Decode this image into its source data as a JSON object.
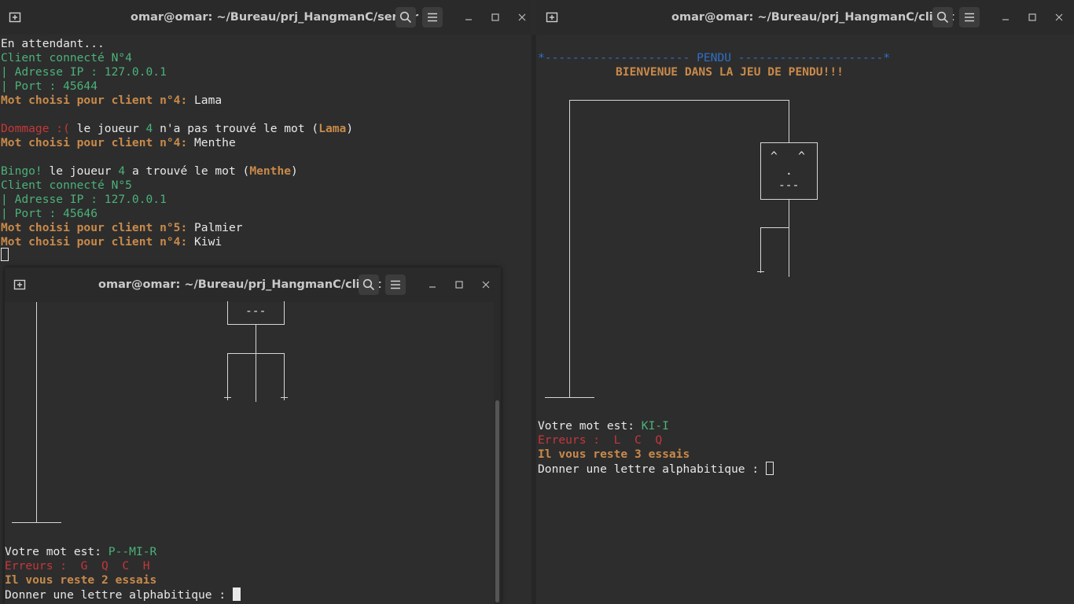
{
  "server": {
    "title": "omar@omar: ~/Bureau/prj_HangmanC/server",
    "lines": {
      "l1": "En attendant...",
      "l2": "Client connecté N°4",
      "l3": "| Adresse IP : 127.0.0.1",
      "l4": "| Port : 45644",
      "l5a": "Mot choisi pour client n°4:",
      "l5b": " Lama",
      "l6a": "Dommage :(",
      "l6b": " le joueur ",
      "l6c": "4",
      "l6d": " n'a pas trouvé le mot (",
      "l6e": "Lama",
      "l6f": ")",
      "l7a": "Mot choisi pour client n°4:",
      "l7b": " Menthe",
      "l8a": "Bingo!",
      "l8b": " le joueur ",
      "l8c": "4",
      "l8d": " a trouvé le mot (",
      "l8e": "Menthe",
      "l8f": ")",
      "l9": "Client connecté N°5",
      "l10": "| Adresse IP : 127.0.0.1",
      "l11": "| Port : 45646",
      "l12a": "Mot choisi pour client n°5:",
      "l12b": " Palmier",
      "l13a": "Mot choisi pour client n°4:",
      "l13b": " Kiwi"
    }
  },
  "client_right": {
    "title": "omar@omar: ~/Bureau/prj_HangmanC/client",
    "banner": "*--------------------- PENDU ---------------------*",
    "welcome": "BIENVENUE DANS LA JEU DE PENDU!!!",
    "face": {
      "eyes": "^   ^",
      "nose": ".",
      "mouth": "---"
    },
    "word_label": "Votre mot est:",
    "word": " KI-I",
    "errors_label": "Erreurs : ",
    "errors": " L  C  Q",
    "remaining": "Il vous reste 3 essais",
    "prompt": "Donner une lettre alphabitique : "
  },
  "client_left": {
    "title": "omar@omar: ~/Bureau/prj_HangmanC/client",
    "face": {
      "mouth": "---"
    },
    "word_label": "Votre mot est:",
    "word": " P--MI-R",
    "errors_label": "Erreurs : ",
    "errors": " G  Q  C  H",
    "remaining": "Il vous reste 2 essais",
    "prompt": "Donner une lettre alphabitique : "
  },
  "colors": {
    "green": "#4bb27a",
    "orange": "#c98a4a",
    "red": "#c6373a",
    "blue": "#2f6fc6",
    "terminal_bg": "#2d2d2d"
  },
  "icons": [
    "new-tab-icon",
    "search-icon",
    "menu-icon",
    "minimize-icon",
    "maximize-icon",
    "close-icon"
  ]
}
